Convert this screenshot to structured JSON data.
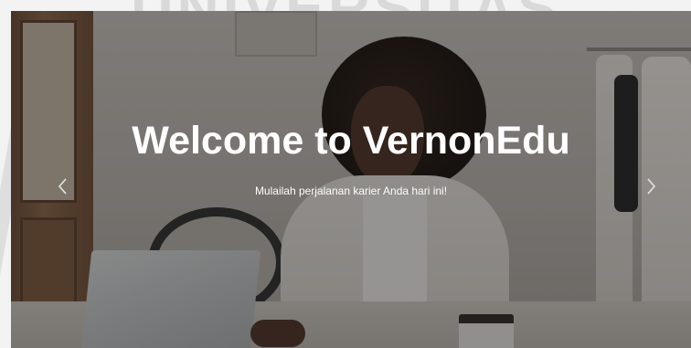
{
  "watermark": {
    "text": "UNIVERSITAS"
  },
  "hero": {
    "title": "Welcome to VernonEdu",
    "subtitle": "Mulailah perjalanan karier Anda hari ini!",
    "prev_icon": "chevron-left-icon",
    "next_icon": "chevron-right-icon"
  },
  "colors": {
    "title_text": "#ffffff",
    "overlay": "rgba(25,25,25,0.42)",
    "page_background": "#f3f3f3"
  }
}
